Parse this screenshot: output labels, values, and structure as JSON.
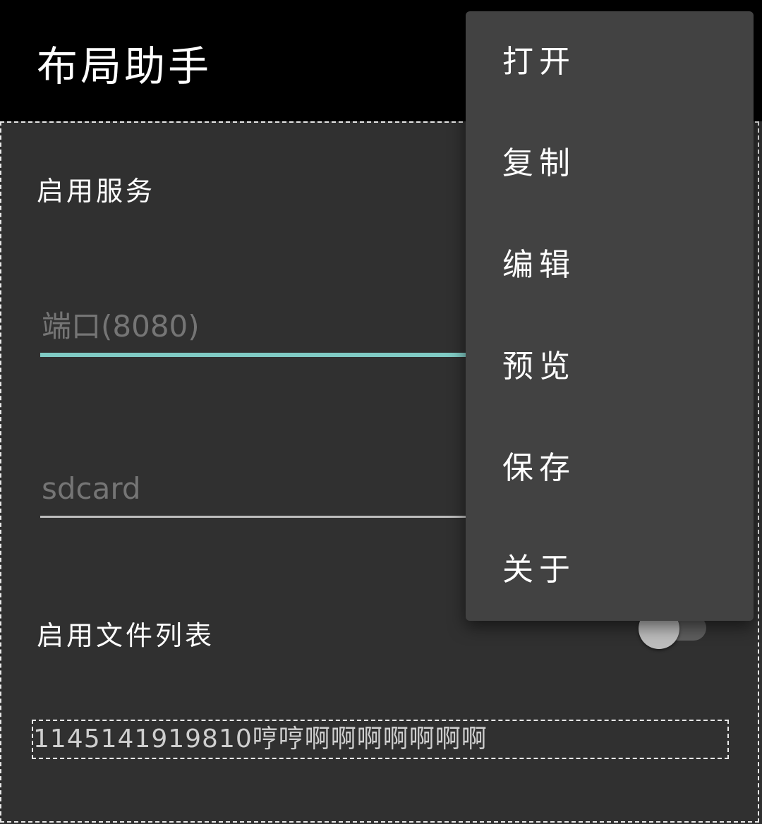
{
  "appbar": {
    "title": "布局助手"
  },
  "settings": {
    "enable_service_label": "启用服务",
    "port_placeholder": "端口(8080)",
    "path_placeholder": "sdcard",
    "enable_file_list_label": "启用文件列表",
    "sample_text": "1145141919810哼哼啊啊啊啊啊啊啊"
  },
  "overflow_menu": {
    "items": [
      {
        "label": "打开"
      },
      {
        "label": "复制"
      },
      {
        "label": "编辑"
      },
      {
        "label": "预览"
      },
      {
        "label": "保存"
      },
      {
        "label": "关于"
      }
    ]
  },
  "colors": {
    "accent": "#80cbc4",
    "appbar_bg": "#000000",
    "content_bg": "#303030",
    "menu_bg": "#424242"
  }
}
